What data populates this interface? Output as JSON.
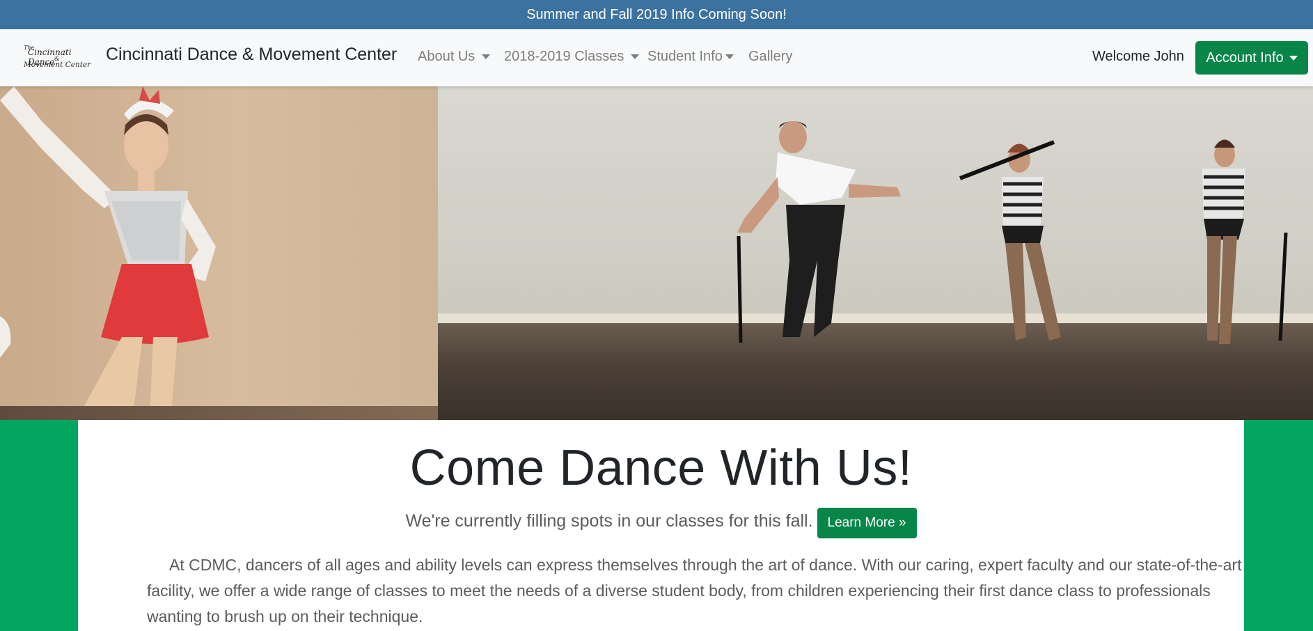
{
  "announcement": "Summer and Fall 2019 Info Coming Soon!",
  "logo": {
    "line1": "The",
    "line2": "Cincinnati Dance",
    "line3": "&",
    "line4": "Movement Center"
  },
  "brand": "Cincinnati Dance & Movement Center",
  "nav": {
    "about": "About Us",
    "classes": "2018-2019 Classes",
    "student": "Student Info",
    "gallery": "Gallery"
  },
  "user": {
    "welcome": "Welcome John",
    "account": "Account Info"
  },
  "main": {
    "title": "Come Dance With Us!",
    "subtitle": "We're currently filling spots in our classes for this fall.",
    "cta": "Learn More »",
    "paragraph": "At CDMC, dancers of all ages and ability levels can express themselves through the art of dance. With our caring, expert faculty and our state-of-the-art facility, we offer a wide range of classes to meet the needs of a diverse student body, from children experiencing their first dance class to professionals wanting to brush up on their technique."
  },
  "colors": {
    "announce_bg": "#3b729f",
    "accent_green": "#08864a",
    "page_green": "#02a661"
  }
}
